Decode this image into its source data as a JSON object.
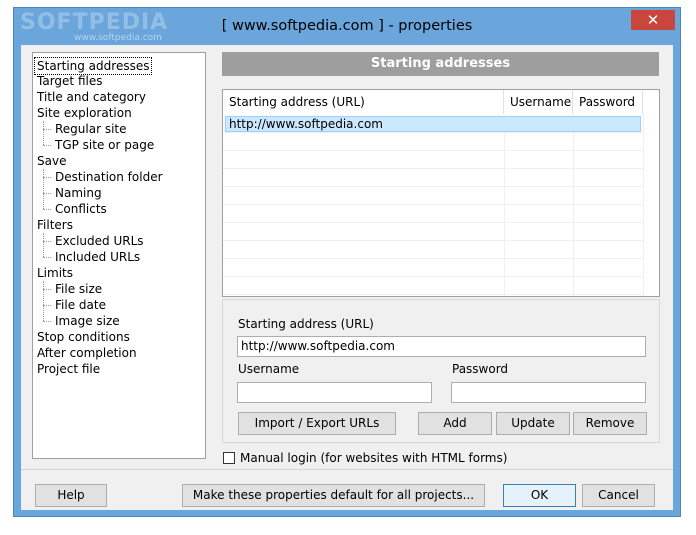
{
  "window": {
    "title": "[ www.softpedia.com ] - properties",
    "close_glyph": "✕",
    "watermark": "SOFTPEDIA",
    "watermark_url": "www.softpedia.com"
  },
  "tree": {
    "items": [
      {
        "label": "Starting addresses",
        "level": 0,
        "selected": true
      },
      {
        "label": "Target files",
        "level": 0
      },
      {
        "label": "Title and category",
        "level": 0
      },
      {
        "label": "Site exploration",
        "level": 0
      },
      {
        "label": "Regular site",
        "level": 1
      },
      {
        "label": "TGP site or page",
        "level": 1
      },
      {
        "label": "Save",
        "level": 0
      },
      {
        "label": "Destination folder",
        "level": 1
      },
      {
        "label": "Naming",
        "level": 1
      },
      {
        "label": "Conflicts",
        "level": 1
      },
      {
        "label": "Filters",
        "level": 0
      },
      {
        "label": "Excluded URLs",
        "level": 1
      },
      {
        "label": "Included URLs",
        "level": 1
      },
      {
        "label": "Limits",
        "level": 0
      },
      {
        "label": "File size",
        "level": 1
      },
      {
        "label": "File date",
        "level": 1
      },
      {
        "label": "Image size",
        "level": 1
      },
      {
        "label": "Stop conditions",
        "level": 0
      },
      {
        "label": "After completion",
        "level": 0
      },
      {
        "label": "Project file",
        "level": 0
      }
    ]
  },
  "section_header": "Starting addresses",
  "grid": {
    "columns": [
      "Starting address (URL)",
      "Username",
      "Password"
    ],
    "rows": [
      [
        "http://www.softpedia.com",
        "",
        ""
      ]
    ]
  },
  "form": {
    "url_label": "Starting address (URL)",
    "url_value": "http://www.softpedia.com",
    "username_label": "Username",
    "username_value": "",
    "password_label": "Password",
    "password_value": "",
    "import_export_button": "Import / Export URLs",
    "add_button": "Add",
    "update_button": "Update",
    "remove_button": "Remove"
  },
  "manual_login": {
    "label": "Manual login (for websites with HTML forms)",
    "checked": false
  },
  "footer": {
    "help_button": "Help",
    "default_button": "Make these properties default for all projects...",
    "ok_button": "OK",
    "cancel_button": "Cancel"
  },
  "colors": {
    "titlebar": "#6aa6db",
    "close": "#c9463d",
    "section_header": "#9e9e9e",
    "selection": "#cce8ff"
  }
}
